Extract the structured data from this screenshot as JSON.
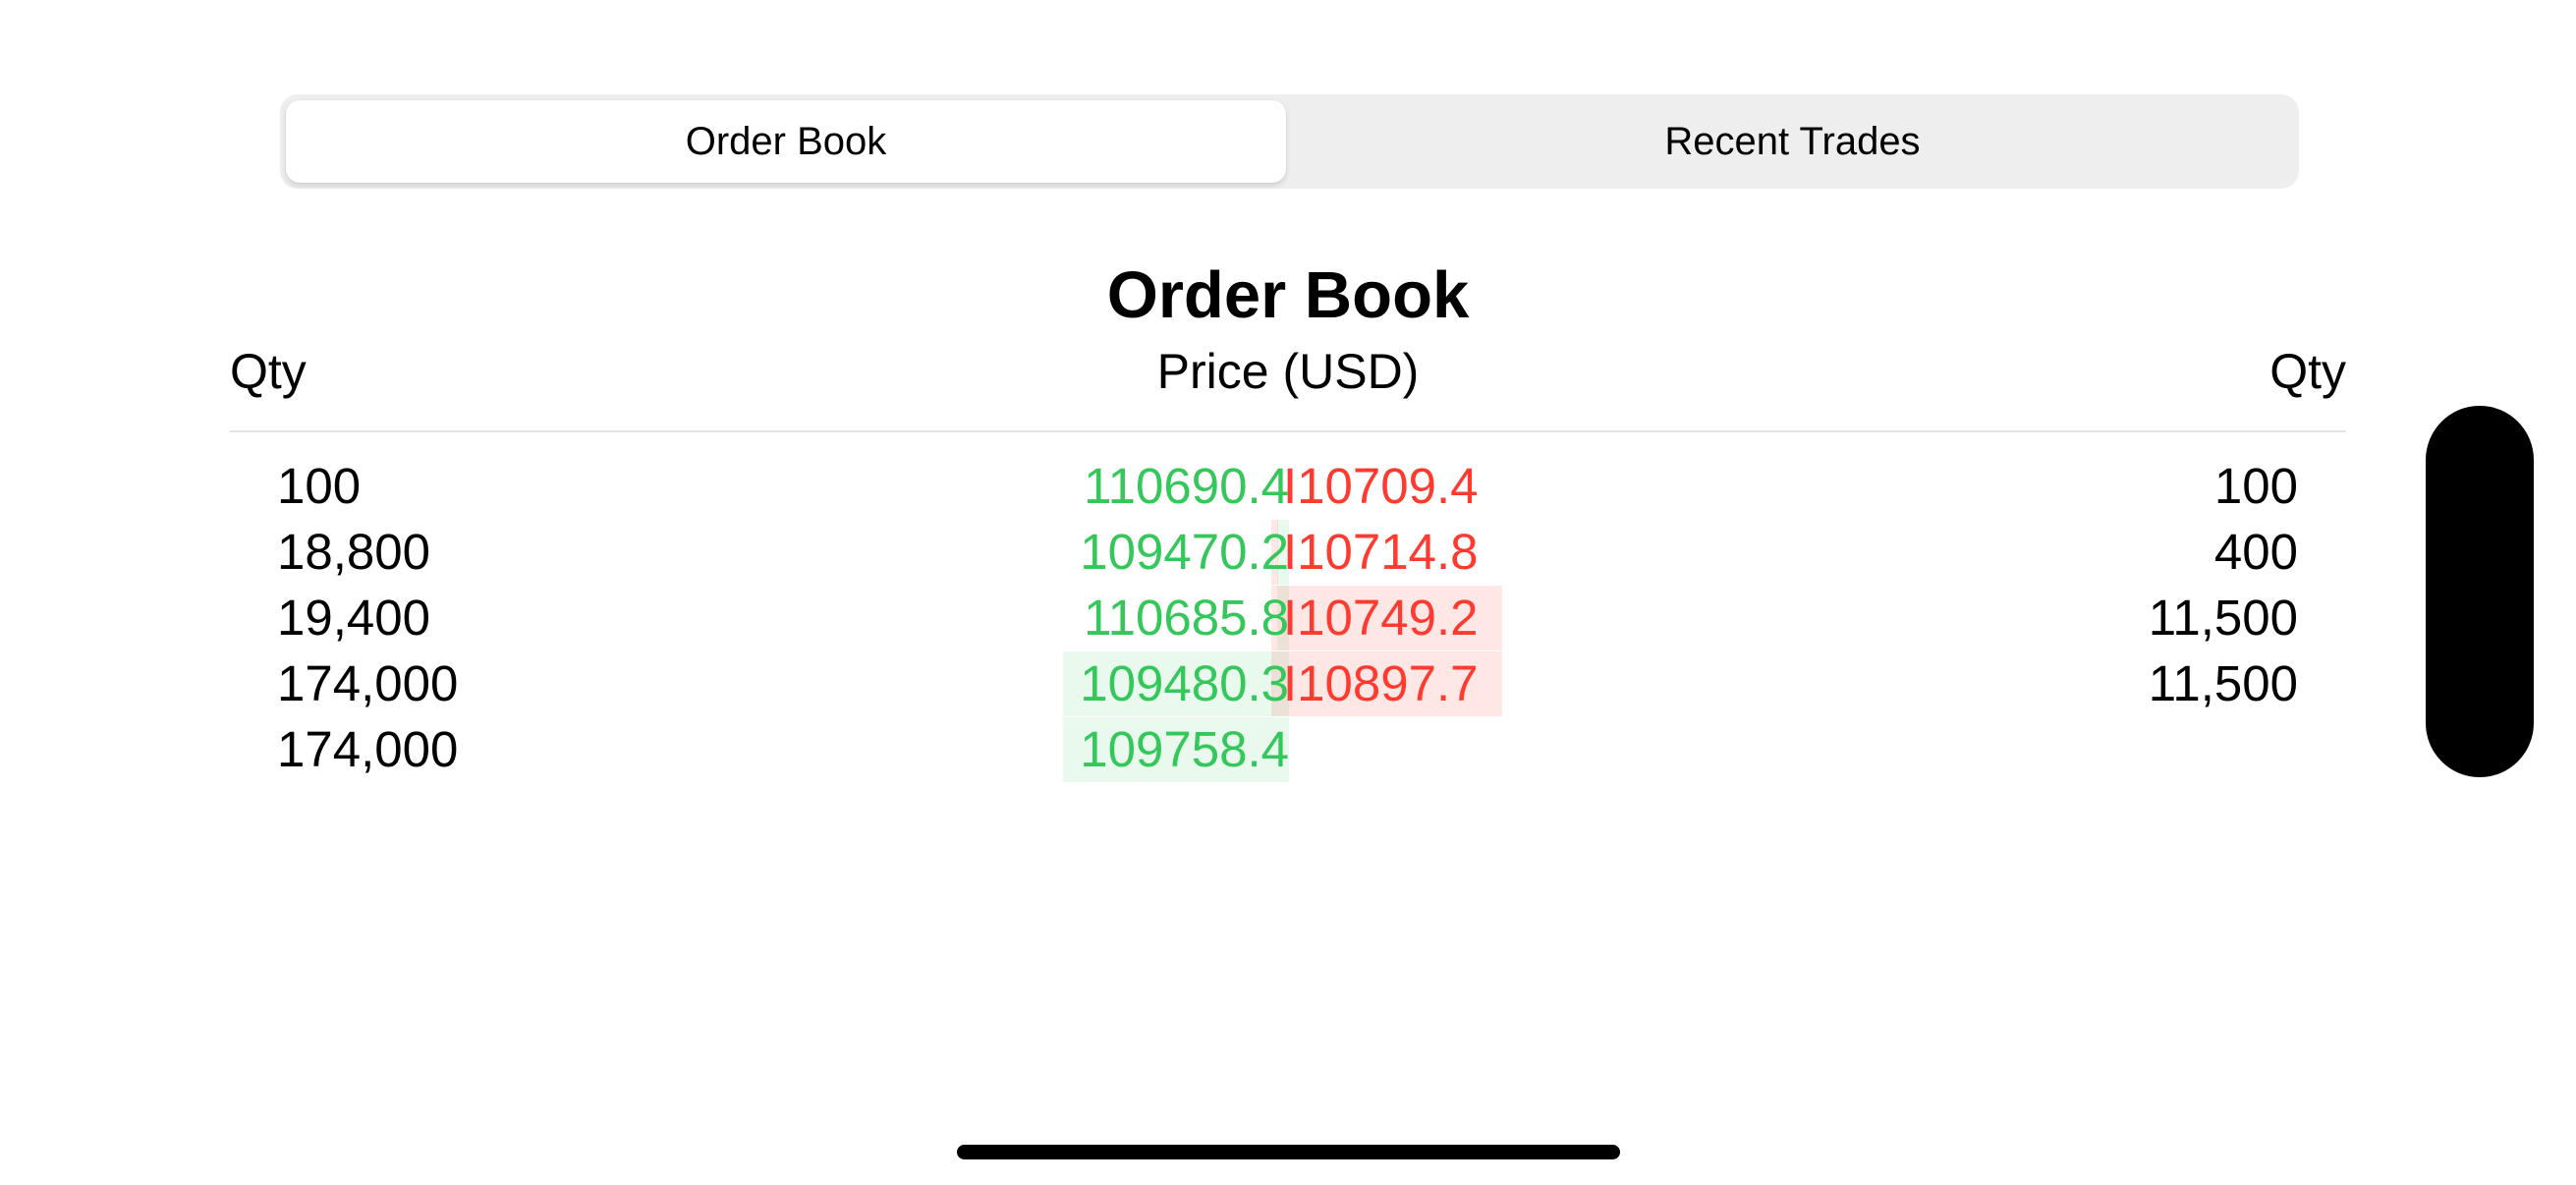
{
  "tabs": [
    {
      "label": "Order Book",
      "selected": true
    },
    {
      "label": "Recent Trades",
      "selected": false
    }
  ],
  "title": "Order Book",
  "columns": {
    "left_qty": "Qty",
    "price": "Price (USD)",
    "right_qty": "Qty"
  },
  "bids": [
    {
      "qty": "100",
      "price": "110690.4",
      "depth": 0.0
    },
    {
      "qty": "18,800",
      "price": "109470.2",
      "depth": 0.05
    },
    {
      "qty": "19,400",
      "price": "110685.8",
      "depth": 0.05
    },
    {
      "qty": "174,000",
      "price": "109480.3",
      "depth": 1.0
    },
    {
      "qty": "174,000",
      "price": "109758.4",
      "depth": 1.0
    }
  ],
  "asks": [
    {
      "qty": "100",
      "price": "I10709.4",
      "depth": 0.0
    },
    {
      "qty": "400",
      "price": "I10714.8",
      "depth": 0.03
    },
    {
      "qty": "11,500",
      "price": "I10749.2",
      "depth": 1.0
    },
    {
      "qty": "11,500",
      "price": "I10897.7",
      "depth": 1.0
    }
  ],
  "colors": {
    "bid": "#34c759",
    "ask": "#ff3b30",
    "segment_bg": "#eeeeef"
  }
}
